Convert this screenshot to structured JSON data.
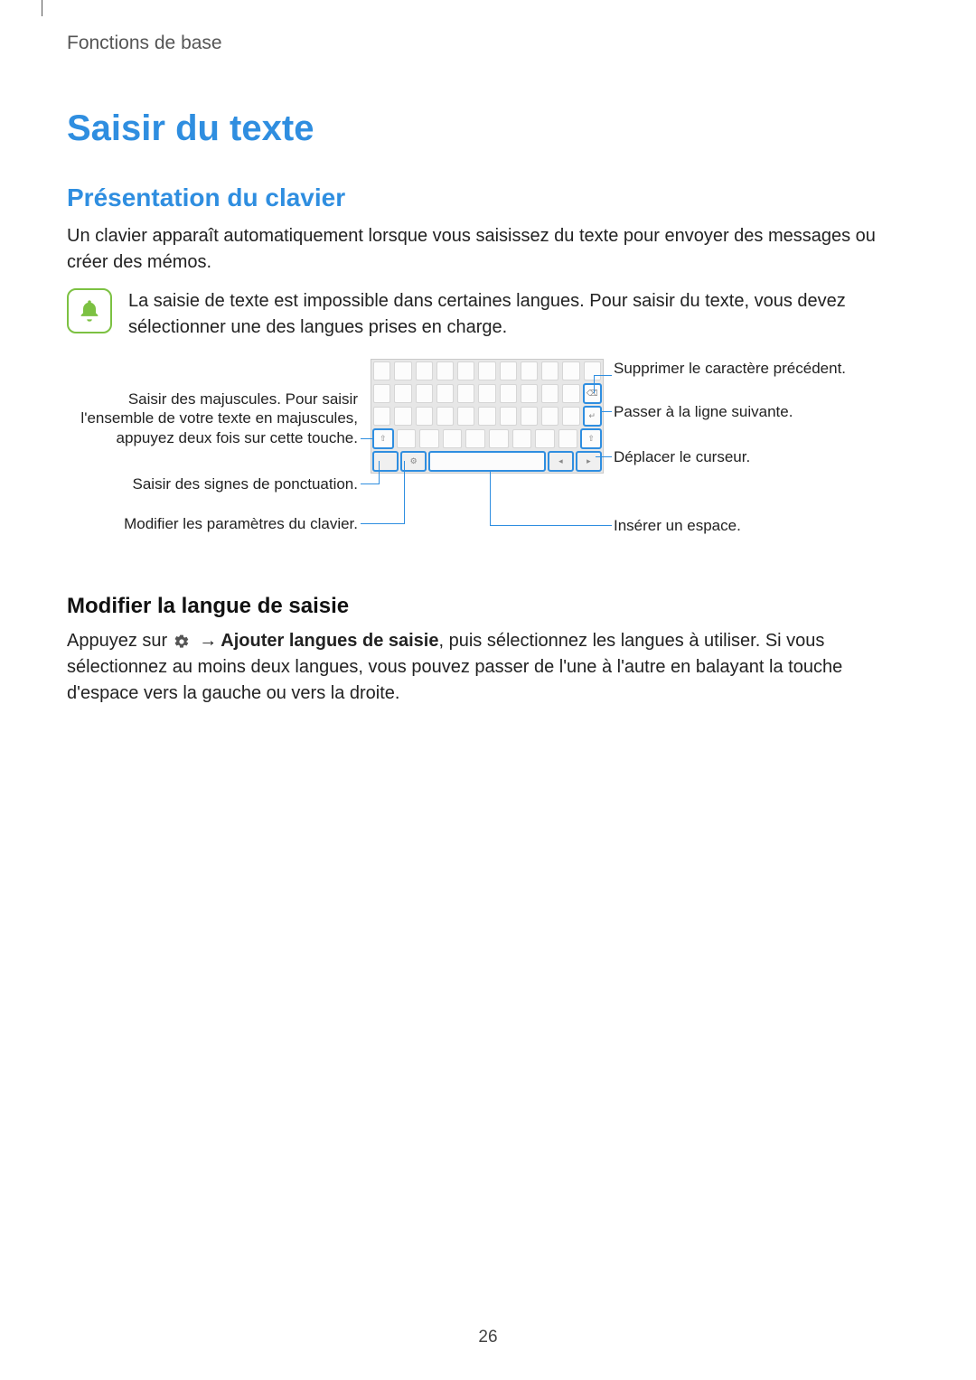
{
  "breadcrumb": "Fonctions de base",
  "title": "Saisir du texte",
  "section1": {
    "heading": "Présentation du clavier",
    "intro": "Un clavier apparaît automatiquement lorsque vous saisissez du texte pour envoyer des messages ou créer des mémos.",
    "note": "La saisie de texte est impossible dans certaines langues. Pour saisir du texte, vous devez sélectionner une des langues prises en charge."
  },
  "callouts": {
    "left_shift": "Saisir des majuscules. Pour saisir l'ensemble de votre texte en majuscules, appuyez deux fois sur cette touche.",
    "left_punct": "Saisir des signes de ponctuation.",
    "left_settings": "Modifier les paramètres du clavier.",
    "right_backspace": "Supprimer le caractère précédent.",
    "right_enter": "Passer à la ligne suivante.",
    "right_cursor": "Déplacer le curseur.",
    "right_space": "Insérer un espace."
  },
  "section2": {
    "heading": "Modifier la langue de saisie",
    "text_before": "Appuyez sur ",
    "arrow": "→",
    "bold": "Ajouter langues de saisie",
    "text_after": ", puis sélectionnez les langues à utiliser. Si vous sélectionnez au moins deux langues, vous pouvez passer de l'une à l'autre en balayant la touche d'espace vers la gauche ou vers la droite."
  },
  "page_number": "26"
}
